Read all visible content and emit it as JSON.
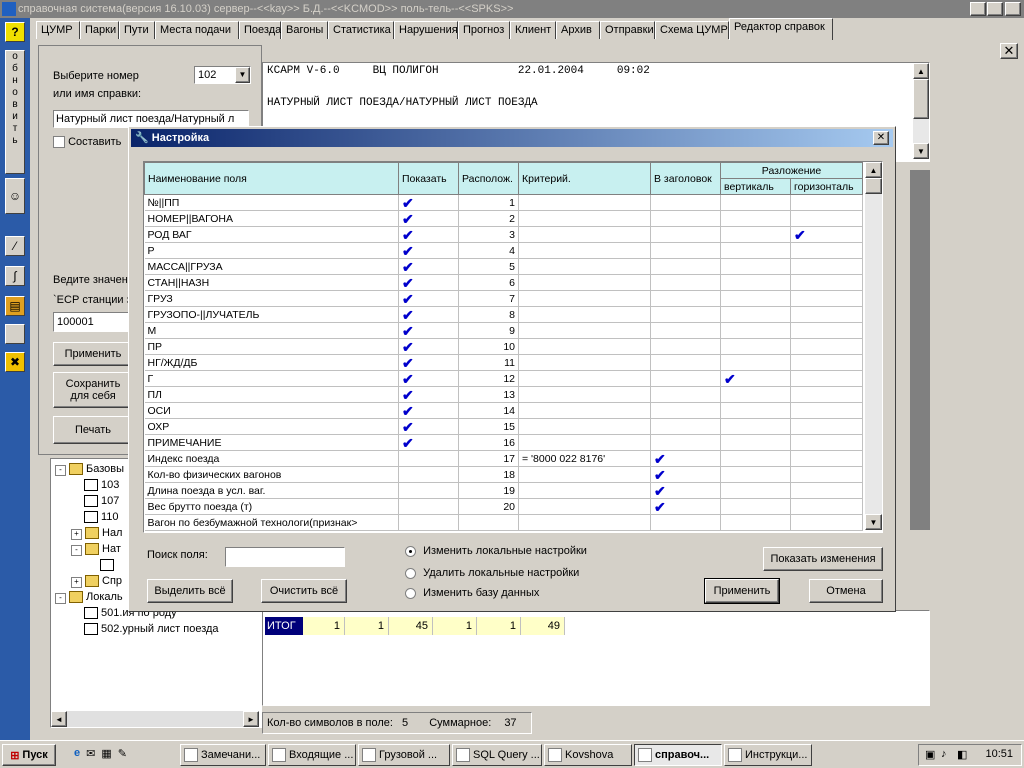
{
  "window": {
    "title": "справочная система(версия 16.10.03) сервер--<<kay>> Б.Д.--<<KCMOD>> поль-тель--<<SPKS>>"
  },
  "left_toolbar": {
    "help": "?",
    "refresh_text": "обновить"
  },
  "tabs": [
    {
      "label": "ЦУМР"
    },
    {
      "label": "Парки"
    },
    {
      "label": "Пути"
    },
    {
      "label": "Места подачи"
    },
    {
      "label": "Поезда"
    },
    {
      "label": "Вагоны"
    },
    {
      "label": "Статистика"
    },
    {
      "label": "Нарушения"
    },
    {
      "label": "Прогноз"
    },
    {
      "label": "Клиент"
    },
    {
      "label": "Архив"
    },
    {
      "label": "Отправки"
    },
    {
      "label": "Схема ЦУМР"
    },
    {
      "label": "Редактор справок"
    }
  ],
  "panel": {
    "select_label_1": "Выберите номер",
    "select_label_2": "или имя справки:",
    "number_value": "102",
    "name_value": "Натурный лист поезда/Натурный л",
    "compose_label": "Составить",
    "enter_label": "Ведите значен",
    "esr_label": "`ЕСР станции з",
    "esr_value": "100001",
    "apply_btn": "Применить",
    "save_btn_1": "Сохранить",
    "save_btn_2": "для себя",
    "print_btn": "Печать"
  },
  "report": {
    "line1": "КСАРМ V-6.0     ВЦ ПОЛИГОН            22.01.2004     09:02",
    "line2": "НАТУРНЫЙ ЛИСТ ПОЕЗДА/НАТУРНЫЙ ЛИСТ ПОЕЗДА"
  },
  "tree": [
    {
      "label": "Базовы",
      "level": 1,
      "type": "folder",
      "exp": "-"
    },
    {
      "label": "103",
      "level": 2,
      "type": "doc"
    },
    {
      "label": "107",
      "level": 2,
      "type": "doc"
    },
    {
      "label": "110",
      "level": 2,
      "type": "doc"
    },
    {
      "label": "Нал",
      "level": 2,
      "type": "folder",
      "exp": "+"
    },
    {
      "label": "Нат",
      "level": 2,
      "type": "folder",
      "exp": "-"
    },
    {
      "label": "",
      "level": 3,
      "type": "doc"
    },
    {
      "label": "Спр",
      "level": 2,
      "type": "folder",
      "exp": "+"
    },
    {
      "label": "Локаль",
      "level": 1,
      "type": "folder",
      "exp": "-"
    },
    {
      "label": "501.ия по роду",
      "level": 2,
      "type": "doc"
    },
    {
      "label": "502.урный лист поезда",
      "level": 2,
      "type": "doc"
    }
  ],
  "totals": {
    "label": "ИТОГ",
    "values": [
      "1",
      "1",
      "45",
      "1",
      "1",
      "49"
    ]
  },
  "status": {
    "chars_label": "Кол-во символов в поле:",
    "chars_value": "5",
    "sum_label": "Суммарное:",
    "sum_value": "37"
  },
  "dialog": {
    "title": "Настройка",
    "headers": {
      "name": "Наименование поля",
      "show": "Показать",
      "pos": "Располож.",
      "crit": "Критерий.",
      "header": "В заголовок",
      "split": "Разложение",
      "vert": "вертикаль",
      "horiz": "горизонталь"
    },
    "rows": [
      {
        "name": "№||ПП",
        "show": "✔",
        "pos": "1",
        "crit": "",
        "hdr": "",
        "vert": "",
        "horiz": ""
      },
      {
        "name": "НОМЕР||ВАГОНА",
        "show": "✔",
        "pos": "2",
        "crit": "",
        "hdr": "",
        "vert": "",
        "horiz": ""
      },
      {
        "name": "РОД ВАГ",
        "show": "✔",
        "pos": "3",
        "crit": "",
        "hdr": "",
        "vert": "",
        "horiz": "✔"
      },
      {
        "name": "Р",
        "show": "✔",
        "pos": "4",
        "crit": "",
        "hdr": "",
        "vert": "",
        "horiz": ""
      },
      {
        "name": "МАССА||ГРУЗА",
        "show": "✔",
        "pos": "5",
        "crit": "",
        "hdr": "",
        "vert": "",
        "horiz": ""
      },
      {
        "name": "СТАН||НАЗН",
        "show": "✔",
        "pos": "6",
        "crit": "",
        "hdr": "",
        "vert": "",
        "horiz": ""
      },
      {
        "name": "ГРУЗ",
        "show": "✔",
        "pos": "7",
        "crit": "",
        "hdr": "",
        "vert": "",
        "horiz": ""
      },
      {
        "name": "ГРУЗОПО-||ЛУЧАТЕЛЬ",
        "show": "✔",
        "pos": "8",
        "crit": "",
        "hdr": "",
        "vert": "",
        "horiz": ""
      },
      {
        "name": "М",
        "show": "✔",
        "pos": "9",
        "crit": "",
        "hdr": "",
        "vert": "",
        "horiz": ""
      },
      {
        "name": "ПР",
        "show": "✔",
        "pos": "10",
        "crit": "",
        "hdr": "",
        "vert": "",
        "horiz": ""
      },
      {
        "name": "НГ/ЖД/ДБ",
        "show": "✔",
        "pos": "11",
        "crit": "",
        "hdr": "",
        "vert": "",
        "horiz": ""
      },
      {
        "name": "Г",
        "show": "✔",
        "pos": "12",
        "crit": "",
        "hdr": "",
        "vert": "✔",
        "horiz": ""
      },
      {
        "name": "ПЛ",
        "show": "✔",
        "pos": "13",
        "crit": "",
        "hdr": "",
        "vert": "",
        "horiz": ""
      },
      {
        "name": "ОСИ",
        "show": "✔",
        "pos": "14",
        "crit": "",
        "hdr": "",
        "vert": "",
        "horiz": ""
      },
      {
        "name": "ОХР",
        "show": "✔",
        "pos": "15",
        "crit": "",
        "hdr": "",
        "vert": "",
        "horiz": ""
      },
      {
        "name": "ПРИМЕЧАНИЕ",
        "show": "✔",
        "pos": "16",
        "crit": "",
        "hdr": "",
        "vert": "",
        "horiz": ""
      },
      {
        "name": "Индекс поезда",
        "show": "",
        "pos": "17",
        "crit": "= '8000 022 8176'",
        "hdr": "✔",
        "vert": "",
        "horiz": ""
      },
      {
        "name": "Кол-во физических вагонов",
        "show": "",
        "pos": "18",
        "crit": "",
        "hdr": "✔",
        "vert": "",
        "horiz": ""
      },
      {
        "name": "Длина поезда в усл. ваг.",
        "show": "",
        "pos": "19",
        "crit": "",
        "hdr": "✔",
        "vert": "",
        "horiz": ""
      },
      {
        "name": "Вес брутто поезда (т)",
        "show": "",
        "pos": "20",
        "crit": "",
        "hdr": "✔",
        "vert": "",
        "horiz": ""
      },
      {
        "name": "Вагон по безбумажной технологи(признак>",
        "show": "",
        "pos": "",
        "crit": "",
        "hdr": "",
        "vert": "",
        "horiz": ""
      }
    ],
    "search_label": "Поиск поля:",
    "search_value": "",
    "select_all": "Выделить всё",
    "clear_all": "Очистить всё",
    "radio_change_local": "Изменить локальные настройки",
    "radio_delete_local": "Удалить локальные настройки",
    "radio_change_db": "Изменить базу данных",
    "show_changes": "Показать изменения",
    "apply": "Применить",
    "cancel": "Отмена"
  },
  "taskbar": {
    "start": "Пуск",
    "tasks": [
      {
        "label": "Замечани..."
      },
      {
        "label": "Входящие ..."
      },
      {
        "label": "Грузовой ..."
      },
      {
        "label": "SQL Query ..."
      },
      {
        "label": "Kovshova"
      },
      {
        "label": "справоч..."
      },
      {
        "label": "Инструкци..."
      }
    ],
    "clock": "10:51"
  }
}
